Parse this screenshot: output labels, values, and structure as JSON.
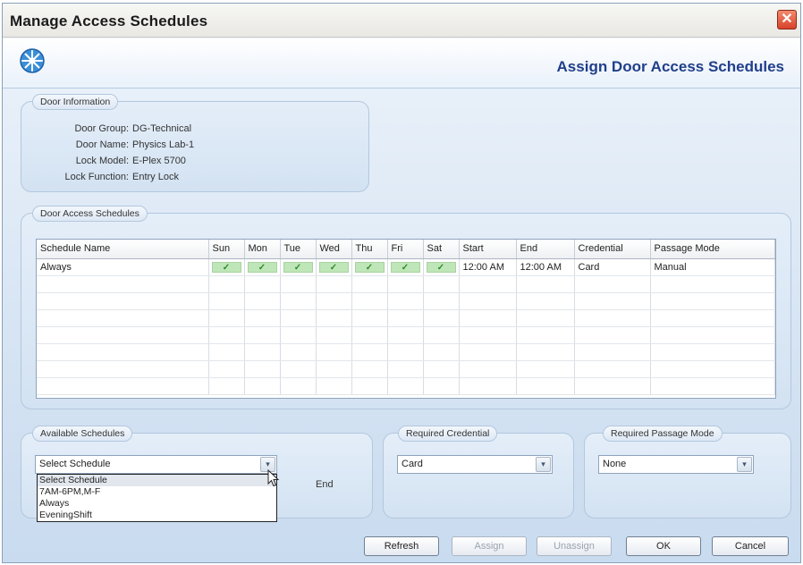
{
  "window": {
    "title": "Manage Access Schedules",
    "close_glyph": "✕"
  },
  "header": {
    "title": "Assign Door Access Schedules",
    "logo_icon": "clock-snowflake-icon"
  },
  "door_info": {
    "legend": "Door Information",
    "rows": [
      {
        "label": "Door Group:",
        "value": "DG-Technical"
      },
      {
        "label": "Door Name:",
        "value": "Physics Lab-1"
      },
      {
        "label": "Lock Model:",
        "value": "E-Plex 5700"
      },
      {
        "label": "Lock Function:",
        "value": "Entry Lock"
      }
    ]
  },
  "schedules": {
    "legend": "Door Access Schedules",
    "columns": [
      "Schedule Name",
      "Sun",
      "Mon",
      "Tue",
      "Wed",
      "Thu",
      "Fri",
      "Sat",
      "Start",
      "End",
      "Credential",
      "Passage Mode"
    ],
    "rows": [
      {
        "name": "Always",
        "days": [
          true,
          true,
          true,
          true,
          true,
          true,
          true
        ],
        "start": "12:00 AM",
        "end": "12:00 AM",
        "credential": "Card",
        "passage_mode": "Manual"
      }
    ],
    "check_glyph": "✓"
  },
  "available": {
    "legend": "Available Schedules",
    "selected": "Select Schedule",
    "options": [
      "Select Schedule",
      "7AM-6PM,M-F",
      "Always",
      "EveningShift"
    ],
    "end_label": "End"
  },
  "credential": {
    "legend": "Required Credential",
    "selected": "Card"
  },
  "passage": {
    "legend": "Required Passage Mode",
    "selected": "None"
  },
  "buttons": {
    "refresh": "Refresh",
    "assign": "Assign",
    "unassign": "Unassign",
    "ok": "OK",
    "cancel": "Cancel"
  },
  "combo_arrow_glyph": "▾"
}
